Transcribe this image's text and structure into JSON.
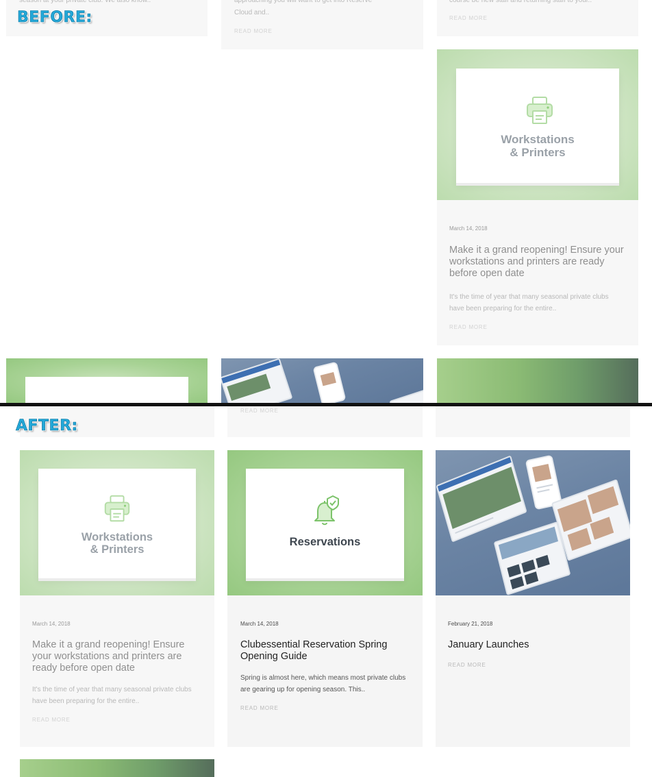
{
  "labels": {
    "before": "BEFORE:",
    "after": "AFTER:"
  },
  "before": {
    "card1": {
      "excerpt_tail": "season at your private club.  We also know.."
    },
    "card2": {
      "excerpt_line1": "approaching you will want to get into Reserve",
      "excerpt_line2": "Cloud and..",
      "read_more": "READ MORE"
    },
    "card3": {
      "excerpt_tail": "course be new staff and returning staff to your..",
      "read_more": "READ MORE"
    },
    "card4": {
      "thumb_title_line1": "Workstations",
      "thumb_title_line2": "& Printers",
      "date": "March 14, 2018",
      "title": "Make it a grand reopening! Ensure your workstations and printers are ready before open date",
      "excerpt": "It's the time of year that many seasonal private clubs have been preparing for the entire..",
      "read_more": "READ MORE"
    }
  },
  "after": {
    "top_read_more": "READ MORE",
    "cards": [
      {
        "thumb_title_line1": "Workstations",
        "thumb_title_line2": "& Printers",
        "date": "March 14, 2018",
        "title": "Make it a grand reopening! Ensure your workstations and printers are ready before open date",
        "excerpt": "It's the time of year that many seasonal private clubs have been preparing for the entire..",
        "read_more": "READ MORE"
      },
      {
        "thumb_title": "Reservations",
        "date": "March 14, 2018",
        "title": "Clubessential Reservation Spring Opening Guide",
        "excerpt": "Spring is almost here, which means most private clubs are gearing up for opening season. This..",
        "read_more": "READ MORE"
      },
      {
        "date": "February 21, 2018",
        "title": "January Launches",
        "read_more": "READ MORE"
      }
    ]
  },
  "colors": {
    "label_blue": "#24a8d8",
    "card_bg": "#f5f5f5",
    "green_accent": "#95c880",
    "divider": "#111111"
  },
  "icons": [
    "printer-icon",
    "bell-check-icon"
  ]
}
